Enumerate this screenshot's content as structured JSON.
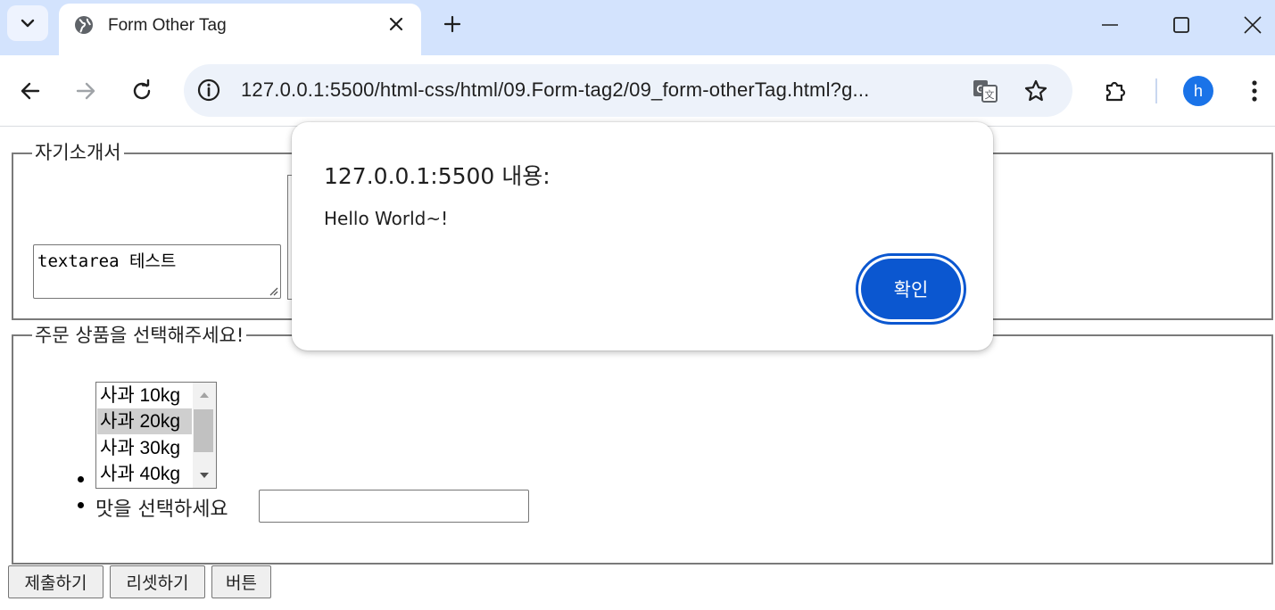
{
  "browser": {
    "tab_title": "Form Other Tag",
    "url": "127.0.0.1:5500/html-css/html/09.Form-tag2/09_form-otherTag.html?g...",
    "profile_initial": "h",
    "icons": {
      "tab_search": "chevron-down-icon",
      "favicon": "globe-icon",
      "close": "close-icon",
      "new_tab": "plus-icon",
      "back": "arrow-left-icon",
      "forward": "arrow-right-icon",
      "reload": "reload-icon",
      "site_info": "info-icon",
      "translate": "translate-icon",
      "bookmark": "star-icon",
      "extensions": "puzzle-icon",
      "menu": "kebab-menu-icon"
    },
    "accent_color": "#0b57d0"
  },
  "page": {
    "fieldset1_legend": "자기소개서",
    "textarea_value": "textarea 테스트",
    "fieldset2_legend": "주문 상품을 선택해주세요!",
    "select_options": [
      {
        "prefix": "사과 ",
        "suffix": "10kg"
      },
      {
        "prefix": "사과 ",
        "suffix": "20kg"
      },
      {
        "prefix": "사과 ",
        "suffix": "30kg"
      },
      {
        "prefix": "사과 ",
        "suffix": "40kg"
      }
    ],
    "selected_option_index": 1,
    "taste_label": "맛을 선택하세요",
    "buttons": {
      "submit": "제출하기",
      "reset": "리셋하기",
      "button": "버튼"
    }
  },
  "dialog": {
    "title": "127.0.0.1:5500 내용:",
    "message": "Hello World~!",
    "ok_label": "확인"
  }
}
